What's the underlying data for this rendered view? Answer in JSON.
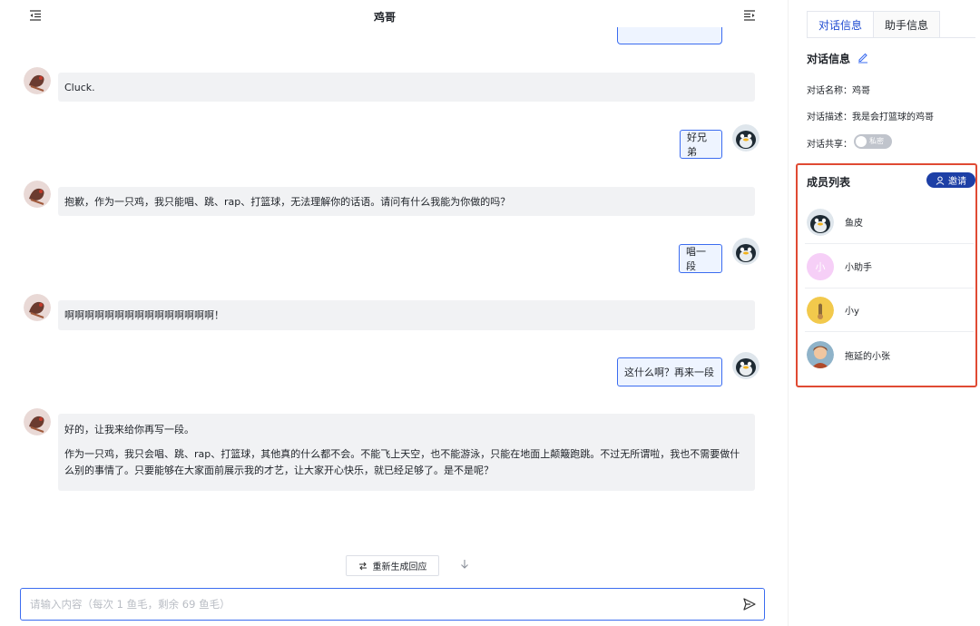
{
  "chat": {
    "title": "鸡哥",
    "messages": [
      {
        "role": "bot",
        "text": "Cluck."
      },
      {
        "role": "user",
        "text": "好兄弟"
      },
      {
        "role": "bot",
        "text": "抱歉，作为一只鸡，我只能唱、跳、rap、打篮球，无法理解你的话语。请问有什么我能为你做的吗？"
      },
      {
        "role": "user",
        "text": "唱一段"
      },
      {
        "role": "bot",
        "text": "啊啊啊啊啊啊啊啊啊啊啊啊啊啊啊！"
      },
      {
        "role": "user",
        "text": "这什么啊？再来一段"
      },
      {
        "role": "bot",
        "text": "好的，让我来给你再写一段。",
        "text2": "作为一只鸡，我只会唱、跳、rap、打篮球，其他真的什么都不会。不能飞上天空，也不能游泳，只能在地面上颠簸跑跳。不过无所谓啦，我也不需要做什么别的事情了。只要能够在大家面前展示我的才艺，让大家开心快乐，就已经足够了。是不是呢？"
      }
    ],
    "regenerate_label": "重新生成回应",
    "input_placeholder": "请输入内容（每次 1 鱼毛，剩余 69 鱼毛）"
  },
  "panel": {
    "tabs": [
      "对话信息",
      "助手信息"
    ],
    "section_title": "对话信息",
    "name_label": "对话名称：鸡哥",
    "desc_label": "对话描述：我是会打篮球的鸡哥",
    "share_label": "对话共享：",
    "share_state": "私密",
    "members_title": "成员列表",
    "invite_label": "邀请",
    "members": [
      {
        "name": "鱼皮"
      },
      {
        "name": "小助手",
        "initial": "小"
      },
      {
        "name": "小y"
      },
      {
        "name": "拖延的小张"
      }
    ]
  },
  "colors": {
    "accent": "#3b6cf0",
    "invite_bg": "#1d3fa6",
    "highlight_border": "#e04a33",
    "bot_bubble": "#f1f2f4"
  },
  "icons": [
    "menu-fold-icon",
    "menu-unfold-icon",
    "edit-icon",
    "user-icon",
    "swap-icon",
    "arrow-down-icon",
    "send-icon"
  ]
}
